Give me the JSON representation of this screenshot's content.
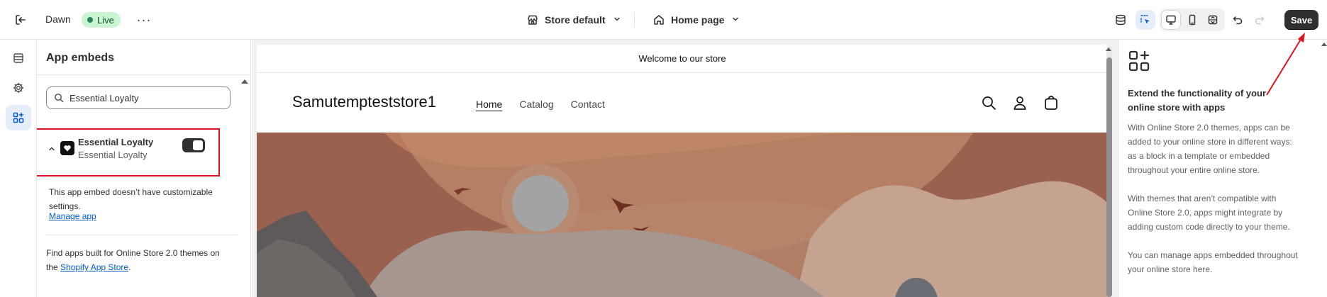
{
  "topbar": {
    "theme_name": "Dawn",
    "status_badge": "Live",
    "more_label": "···",
    "store_selector": "Store default",
    "page_selector": "Home page",
    "save_label": "Save"
  },
  "rail": {
    "items": [
      "sections-icon",
      "settings-gear-icon",
      "app-embeds-icon"
    ],
    "active": "app-embeds-icon"
  },
  "sidebar": {
    "title": "App embeds",
    "search_value": "Essential Loyalty",
    "app": {
      "name": "Essential Loyalty",
      "subtitle": "Essential Loyalty",
      "enabled": true
    },
    "app_description": "This app embed doesn’t have customizable settings.",
    "manage_link": "Manage app",
    "find_apps_prefix": "Find apps built for Online Store 2.0 themes on the ",
    "find_apps_link": "Shopify App Store",
    "find_apps_suffix": "."
  },
  "preview": {
    "announcement": "Welcome to our store",
    "store_name": "Samutempteststore1",
    "nav": [
      "Home",
      "Catalog",
      "Contact"
    ],
    "active_nav": "Home"
  },
  "right_panel": {
    "title": "Extend the functionality of your online store with apps",
    "paragraphs": [
      "With Online Store 2.0 themes, apps can be added to your online store in different ways: as a block in a template or embedded throughout your entire online store.",
      "With themes that aren’t compatible with Online Store 2.0, apps might integrate by adding custom code directly to your theme.",
      "You can manage apps embedded throughout your online store here."
    ]
  },
  "colors": {
    "accent_blue": "#005bd3",
    "live_badge_bg": "#c9f5d2",
    "highlight_red": "#e0141e",
    "save_bg": "#303030"
  }
}
